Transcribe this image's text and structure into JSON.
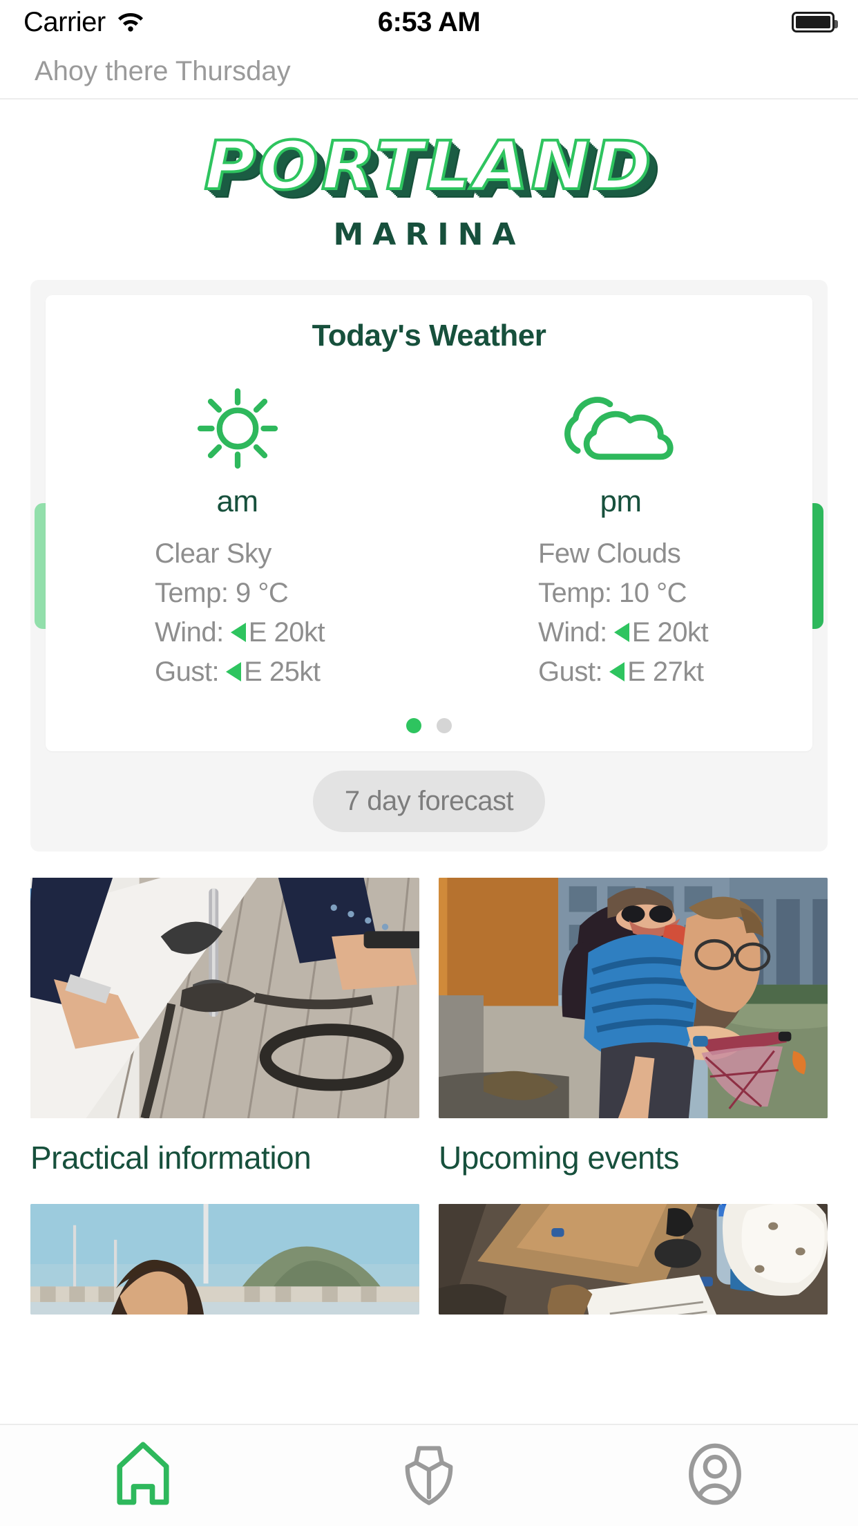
{
  "status_bar": {
    "carrier": "Carrier",
    "wifi_icon": "wifi-icon",
    "time": "6:53 AM",
    "battery_icon": "battery-full-icon"
  },
  "header": {
    "greeting": "Ahoy there Thursday"
  },
  "logo": {
    "primary": "PORTLAND",
    "secondary": "MARINA",
    "primary_color": "#2ec45f",
    "shadow_color": "#1b5c43",
    "secondary_color": "#17503c"
  },
  "weather": {
    "title": "Today's Weather",
    "prev_label": "prev-slide",
    "next_label": "next-slide",
    "forecast_button": "7 day forecast",
    "dots": [
      {
        "active": true
      },
      {
        "active": false
      }
    ],
    "columns": [
      {
        "period": "am",
        "icon": "sun-icon",
        "condition": "Clear Sky",
        "temp": "Temp: 9 °C",
        "wind_label": "Wind:",
        "wind_value": "E 20kt",
        "gust_label": "Gust:",
        "gust_value": "E 25kt",
        "wind_arrow_icon": "wind-direction-arrow-icon"
      },
      {
        "period": "pm",
        "icon": "cloud-icon",
        "condition": "Few Clouds",
        "temp": "Temp: 10 °C",
        "wind_label": "Wind:",
        "wind_value": "E 20kt",
        "gust_label": "Gust:",
        "gust_value": "E 27kt",
        "wind_arrow_icon": "wind-direction-arrow-icon"
      }
    ]
  },
  "tiles": [
    {
      "label": "Practical information",
      "image": "hands-tying-rope-knot-on-boat-deck"
    },
    {
      "label": "Upcoming events",
      "image": "boy-with-crab-net-at-marina"
    },
    {
      "label": "",
      "image": "man-looking-at-harbour-with-mountains"
    },
    {
      "label": "",
      "image": "table-with-water-bottle-and-white-hat"
    }
  ],
  "tabbar": {
    "items": [
      {
        "name": "home",
        "icon": "home-icon",
        "active": true
      },
      {
        "name": "boat",
        "icon": "boat-bow-icon",
        "active": false
      },
      {
        "name": "account",
        "icon": "account-icon",
        "active": false
      }
    ],
    "active_color": "#2ec45f",
    "inactive_color": "#9a9a9a"
  }
}
